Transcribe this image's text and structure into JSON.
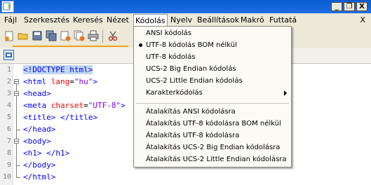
{
  "window": {
    "minimize_glyph": "_",
    "restore_glyph": "❐",
    "close_glyph": "X"
  },
  "menubar": {
    "items": [
      {
        "id": "fajl",
        "label": "Fájl"
      },
      {
        "id": "szerkesztes",
        "label": "Szerkesztés"
      },
      {
        "id": "kereses",
        "label": "Keresés"
      },
      {
        "id": "nezet",
        "label": "Nézet"
      },
      {
        "id": "kodolas",
        "label": "Kódolás"
      },
      {
        "id": "nyelv",
        "label": "Nyelv"
      },
      {
        "id": "beallitasok",
        "label": "Beállítások"
      },
      {
        "id": "makro",
        "label": "Makró"
      },
      {
        "id": "futtatas",
        "label": "Futtatá"
      }
    ],
    "close_label": "X"
  },
  "encoding_menu": {
    "group1": [
      {
        "label": "ANSI kódolás",
        "checked": false
      },
      {
        "label": "UTF-8 kódolás BOM nélkül",
        "checked": true
      },
      {
        "label": "UTF-8 kódolás",
        "checked": false
      },
      {
        "label": "UCS-2 Big Endian kódolás",
        "checked": false
      },
      {
        "label": "UCS-2 Little Endian kódolás",
        "checked": false
      },
      {
        "label": "Karakterkódolás",
        "checked": false,
        "submenu": true
      }
    ],
    "group2": [
      {
        "label": "Átalakítás ANSI kódolásra"
      },
      {
        "label": "Átalakítás UTF-8 kódolásra BOM nélkül"
      },
      {
        "label": "Átalakítás UTF-8 kódolásra"
      },
      {
        "label": "Átalakítás UCS-2 Big Endian kódolásra"
      },
      {
        "label": "Átalakítás UCS-2 Little Endian kódolásra"
      }
    ]
  },
  "editor": {
    "lines": [
      {
        "n": "1",
        "parts": [
          {
            "t": "<!DOCTYPE html>",
            "c": "tag sel"
          }
        ]
      },
      {
        "n": "2",
        "parts": [
          {
            "t": "<html ",
            "c": "tag"
          },
          {
            "t": "lang",
            "c": "attr"
          },
          {
            "t": "=",
            "c": "txt"
          },
          {
            "t": "\"hu\"",
            "c": "val"
          },
          {
            "t": ">",
            "c": "tag"
          }
        ]
      },
      {
        "n": "3",
        "parts": [
          {
            "t": "<head>",
            "c": "tag"
          }
        ]
      },
      {
        "n": "4",
        "parts": [
          {
            "t": "<meta ",
            "c": "tag"
          },
          {
            "t": "charset",
            "c": "attr"
          },
          {
            "t": "=",
            "c": "txt"
          },
          {
            "t": "\"UTF-8\"",
            "c": "val"
          },
          {
            "t": ">",
            "c": "tag"
          }
        ]
      },
      {
        "n": "5",
        "parts": [
          {
            "t": "<title>",
            "c": "tag"
          },
          {
            "t": " ",
            "c": "txt"
          },
          {
            "t": "</title>",
            "c": "tag"
          }
        ]
      },
      {
        "n": "6",
        "parts": [
          {
            "t": "</head>",
            "c": "tag"
          }
        ]
      },
      {
        "n": "7",
        "parts": [
          {
            "t": "<body>",
            "c": "tag"
          }
        ]
      },
      {
        "n": "8",
        "parts": [
          {
            "t": "<h1>",
            "c": "tag"
          },
          {
            "t": " ",
            "c": "txt"
          },
          {
            "t": "</h1>",
            "c": "tag"
          }
        ]
      },
      {
        "n": "9",
        "parts": [
          {
            "t": "</body>",
            "c": "tag"
          }
        ]
      },
      {
        "n": "10",
        "parts": [
          {
            "t": "</html>",
            "c": "tag"
          }
        ]
      }
    ]
  },
  "toolbar": {
    "icons": [
      "new-file-icon",
      "open-file-icon",
      "save-icon",
      "save-all-icon",
      "close-icon",
      "close-all-icon",
      "print-icon",
      "cut-icon"
    ]
  },
  "colors": {
    "tag": "#0000ff",
    "attribute": "#ff0000",
    "value": "#8000ff",
    "title_bar": "#0a5ad0",
    "selection": "#c0d7f0"
  }
}
